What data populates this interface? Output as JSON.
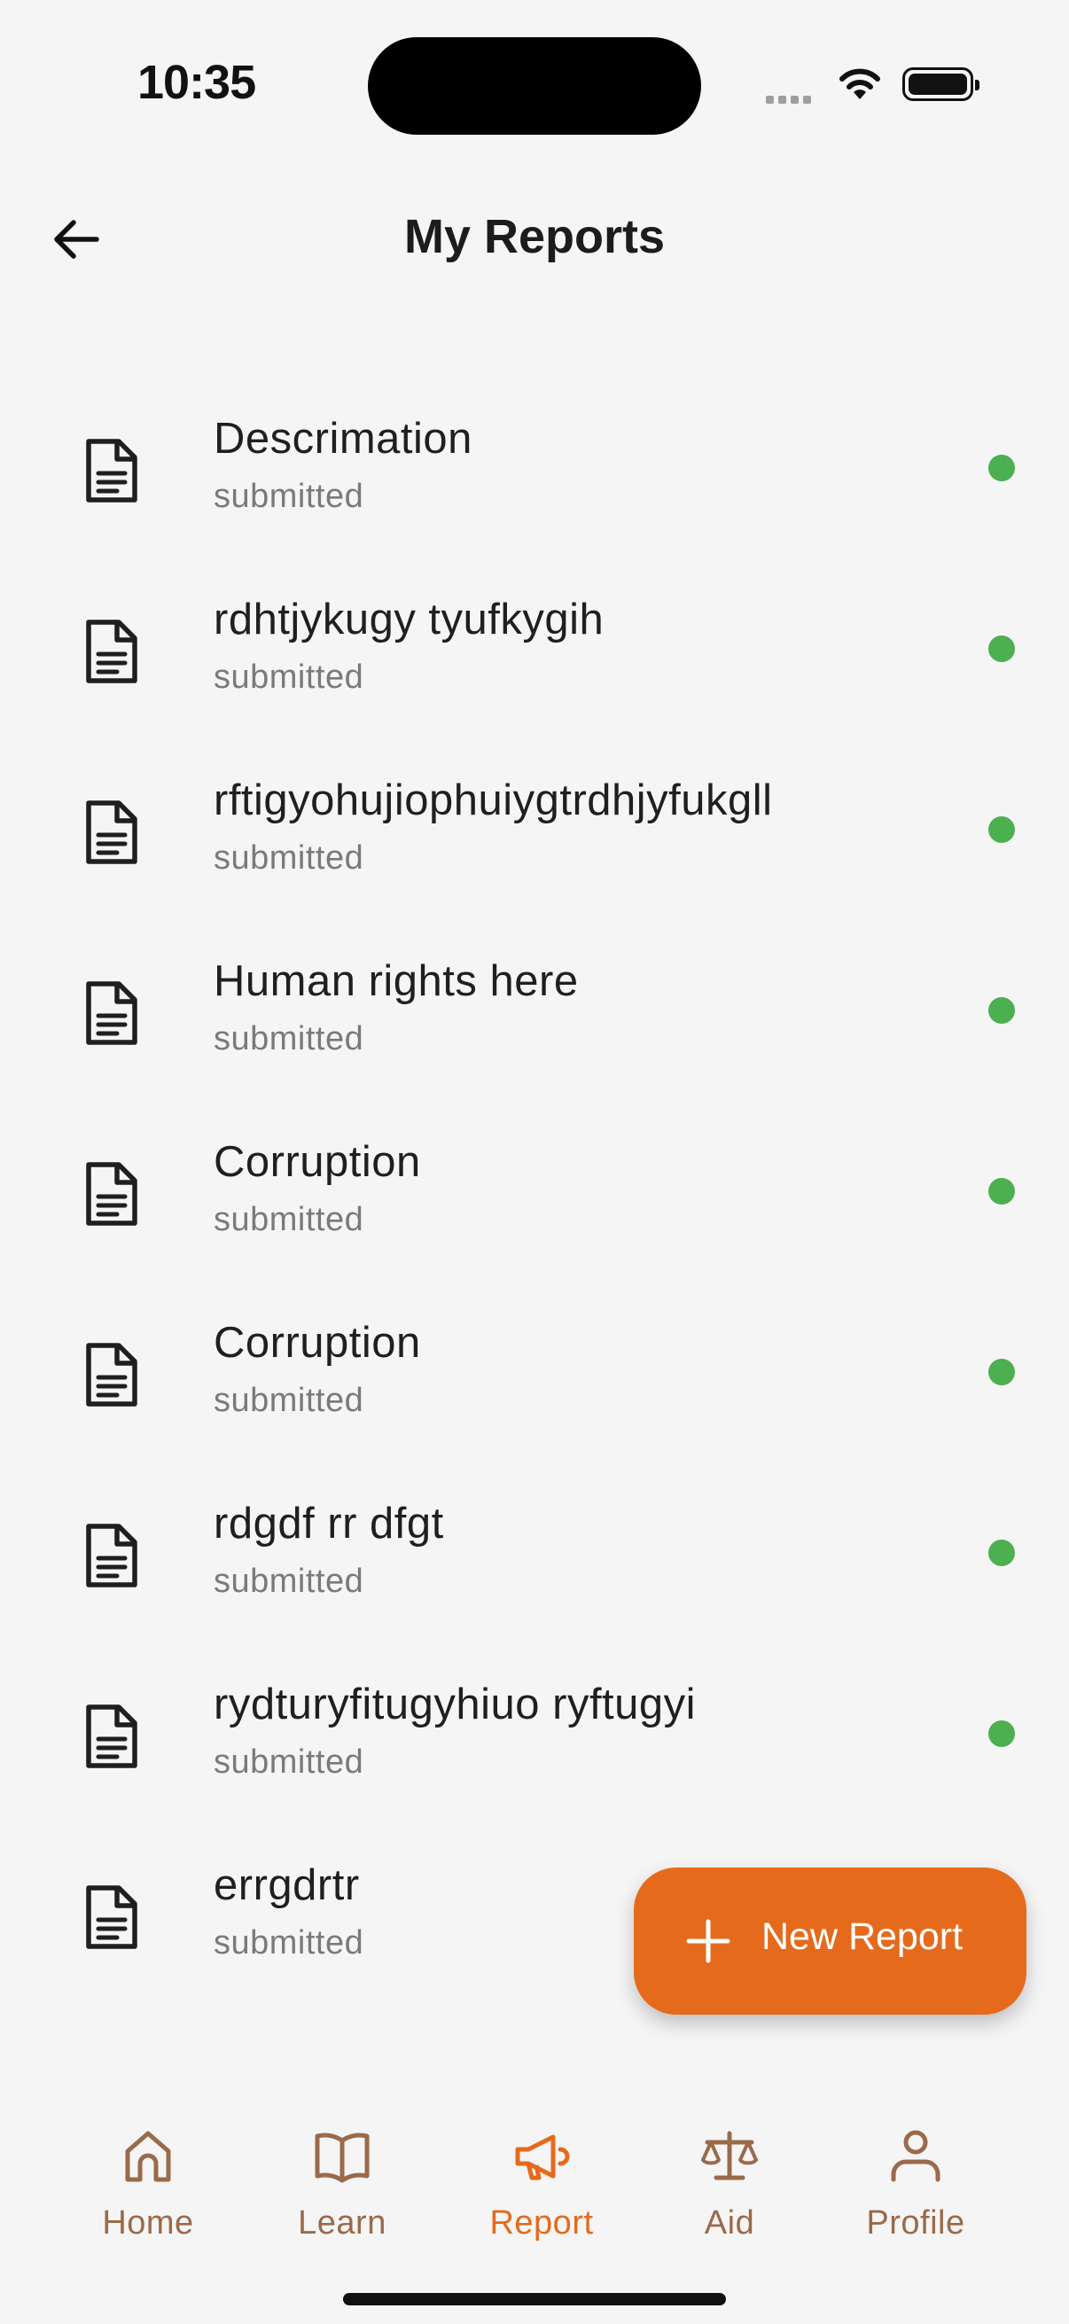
{
  "status_bar": {
    "time": "10:35"
  },
  "header": {
    "title": "My Reports"
  },
  "reports": [
    {
      "title": "Descrimation",
      "status": "submitted"
    },
    {
      "title": "rdhtjykugy tyufkygih",
      "status": "submitted"
    },
    {
      "title": "rftigyohujiophuiygtrdhjyfukgll",
      "status": "submitted"
    },
    {
      "title": "Human rights here",
      "status": "submitted"
    },
    {
      "title": "Corruption",
      "status": "submitted"
    },
    {
      "title": "Corruption",
      "status": "submitted"
    },
    {
      "title": "rdgdf rr dfgt",
      "status": "submitted"
    },
    {
      "title": "rydturyfitugyhiuo ryftugyi",
      "status": "submitted"
    },
    {
      "title": "errgdrtr",
      "status": "submitted"
    }
  ],
  "fab": {
    "label": "New Report",
    "icon": "plus-icon"
  },
  "nav": {
    "items": [
      {
        "label": "Home",
        "icon": "home-icon"
      },
      {
        "label": "Learn",
        "icon": "book-icon"
      },
      {
        "label": "Report",
        "icon": "megaphone-icon"
      },
      {
        "label": "Aid",
        "icon": "scales-icon"
      },
      {
        "label": "Profile",
        "icon": "person-icon"
      }
    ],
    "active": "Report"
  },
  "colors": {
    "accent": "#e56a1c",
    "status_submitted": "#4caf50",
    "nav_inactive": "#9a6a4a",
    "background": "#f5f5f5"
  }
}
